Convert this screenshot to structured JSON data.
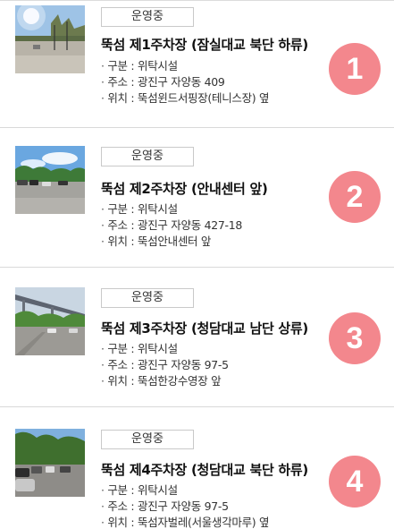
{
  "lots": [
    {
      "status": "운영중",
      "title": "뚝섬 제1주차장 (잠실대교 북단 하류)",
      "type": "구분 : 위탁시설",
      "address": "주소 : 광진구 자양동 409",
      "location": "위치 : 뚝섬윈드서핑장(테니스장) 옆",
      "number": "1",
      "photo": "parking-lot-photo-1"
    },
    {
      "status": "운영중",
      "title": "뚝섬 제2주차장 (안내센터 앞)",
      "type": "구분 : 위탁시설",
      "address": "주소 : 광진구 자양동 427-18",
      "location": "위치 : 뚝섬안내센터 앞",
      "number": "2",
      "photo": "parking-lot-photo-2"
    },
    {
      "status": "운영중",
      "title": "뚝섬 제3주차장 (청담대교 남단 상류)",
      "type": "구분 : 위탁시설",
      "address": "주소 : 광진구 자양동 97-5",
      "location": "위치 : 뚝섬한강수영장 앞",
      "number": "3",
      "photo": "parking-lot-photo-3"
    },
    {
      "status": "운영중",
      "title": "뚝섬 제4주차장 (청담대교 북단 하류)",
      "type": "구분 : 위탁시설",
      "address": "주소 : 광진구 자양동 97-5",
      "location": "위치 : 뚝섬자벌레(서울생각마루) 옆",
      "number": "4",
      "photo": "parking-lot-photo-4"
    }
  ],
  "colors": {
    "badge": "#f3878d",
    "divider": "#d9d9d9",
    "status_border": "#c9c9c9"
  }
}
